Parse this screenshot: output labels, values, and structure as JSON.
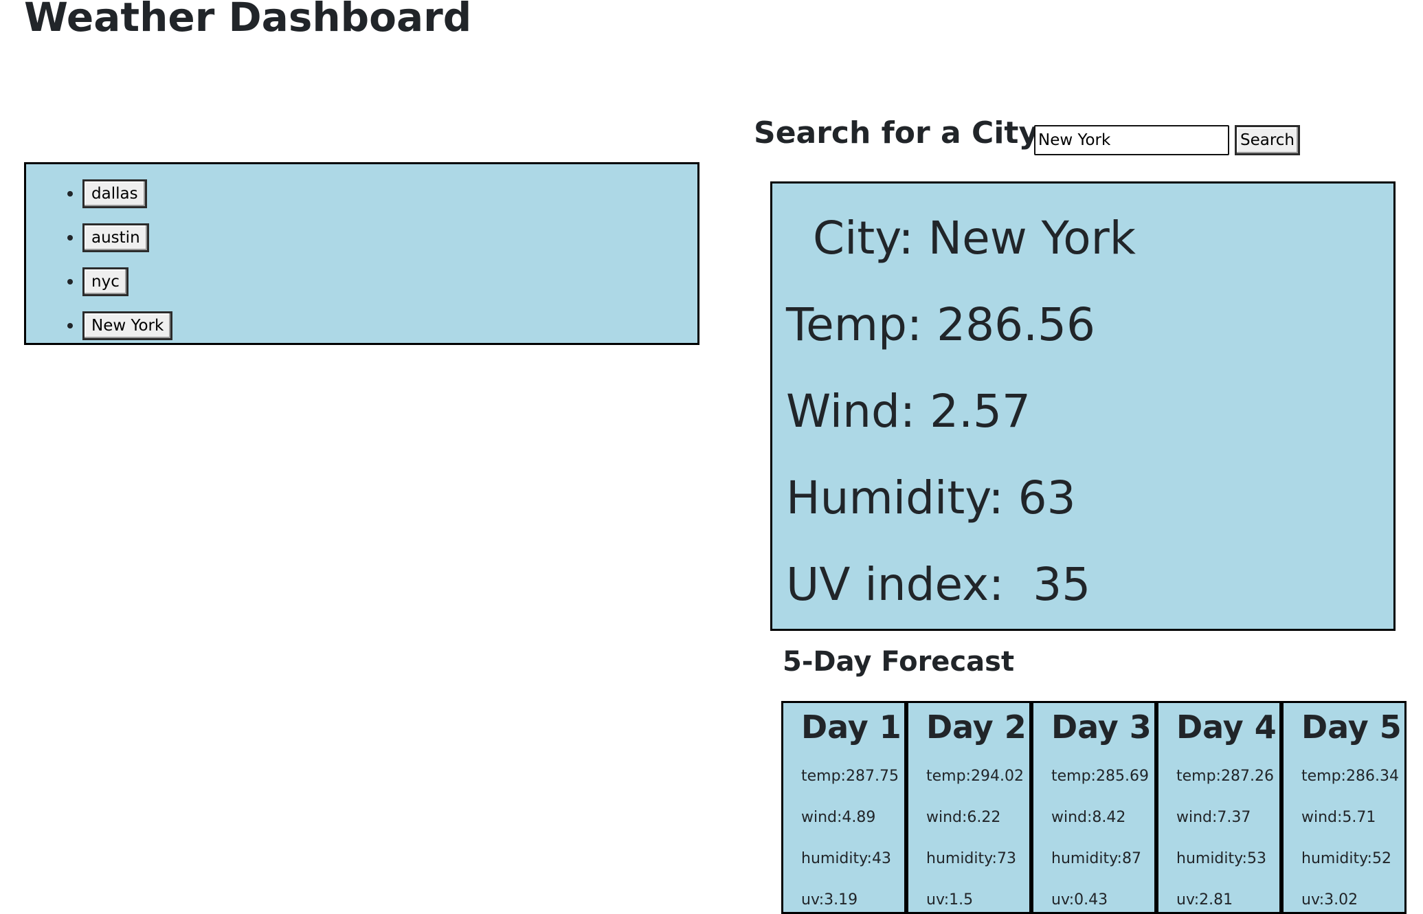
{
  "header": {
    "title": "Weather Dashboard"
  },
  "history": {
    "items": [
      {
        "label": "dallas"
      },
      {
        "label": "austin"
      },
      {
        "label": "nyc"
      },
      {
        "label": "New York"
      }
    ]
  },
  "search": {
    "label": "Search for a City:",
    "value": "New York",
    "button_label": "Search"
  },
  "current": {
    "city": " City: New York",
    "temp": "Temp: 286.56",
    "wind": "Wind: 2.57",
    "humidity": "Humidity: 63",
    "uv": "UV index:  35"
  },
  "forecast": {
    "title": "5-Day Forecast",
    "days": [
      {
        "label": "Day 1",
        "temp": "temp:287.75",
        "wind": "wind:4.89",
        "humidity": "humidity:43",
        "uv": "uv:3.19"
      },
      {
        "label": "Day 2",
        "temp": "temp:294.02",
        "wind": "wind:6.22",
        "humidity": "humidity:73",
        "uv": "uv:1.5"
      },
      {
        "label": "Day 3",
        "temp": "temp:285.69",
        "wind": "wind:8.42",
        "humidity": "humidity:87",
        "uv": "uv:0.43"
      },
      {
        "label": "Day 4",
        "temp": "temp:287.26",
        "wind": "wind:7.37",
        "humidity": "humidity:53",
        "uv": "uv:2.81"
      },
      {
        "label": "Day 5",
        "temp": "temp:286.34",
        "wind": "wind:5.71",
        "humidity": "humidity:52",
        "uv": "uv:3.02"
      }
    ]
  },
  "colors": {
    "panel": "#add8e6",
    "border": "#000000",
    "text": "#212529"
  }
}
